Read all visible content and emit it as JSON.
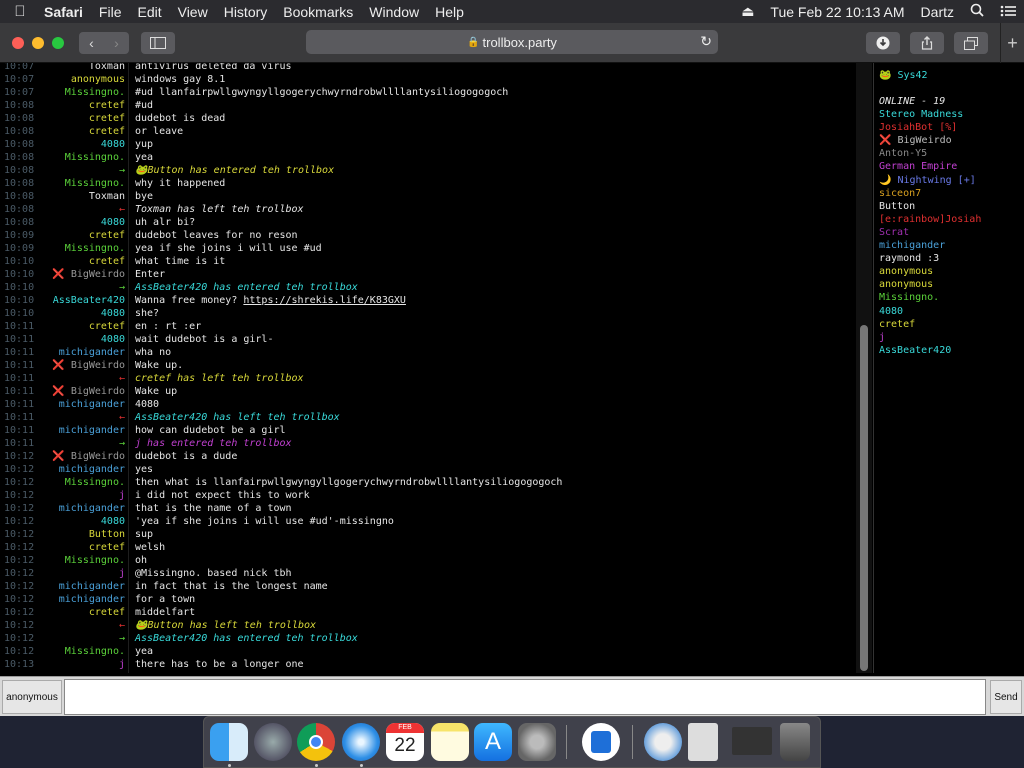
{
  "menubar": {
    "app": "Safari",
    "items": [
      "File",
      "Edit",
      "View",
      "History",
      "Bookmarks",
      "Window",
      "Help"
    ],
    "datetime": "Tue Feb 22  10:13 AM",
    "user": "Dartz"
  },
  "toolbar": {
    "url": "trollbox.party",
    "lock_icon": "🔒"
  },
  "colors": {
    "timestamp": "#4a5a66",
    "green": "#5bd13a",
    "cyan": "#39d9d9",
    "yellow": "#d8d83a",
    "blue": "#4aa0d8",
    "grey": "#999999"
  },
  "chat": {
    "messages": [
      {
        "time": "10:07",
        "nick": "Toxman",
        "nick_color": "#e6e6e6",
        "text": "antivirus deleted da virus",
        "sys": false
      },
      {
        "time": "10:07",
        "nick": "anonymous",
        "nick_color": "#d8d83a",
        "text": "windows gay 8.1",
        "sys": false
      },
      {
        "time": "10:07",
        "nick": "Missingno.",
        "nick_color": "#5bd13a",
        "text": "#ud llanfairpwllgwyngyllgogerychwyrndrobwllllantysiliogogogoch",
        "sys": false
      },
      {
        "time": "10:08",
        "nick": "cretef",
        "nick_color": "#d8d83a",
        "text": "#ud",
        "sys": false
      },
      {
        "time": "10:08",
        "nick": "cretef",
        "nick_color": "#d8d83a",
        "text": "dudebot is dead",
        "sys": false
      },
      {
        "time": "10:08",
        "nick": "cretef",
        "nick_color": "#d8d83a",
        "text": "or leave",
        "sys": false
      },
      {
        "time": "10:08",
        "nick": "4080",
        "nick_color": "#39d9d9",
        "text": "yup",
        "sys": false
      },
      {
        "time": "10:08",
        "nick": "Missingno.",
        "nick_color": "#5bd13a",
        "text": "yea",
        "sys": false
      },
      {
        "time": "10:08",
        "nick": "→",
        "nick_color": "#5bd13a",
        "text": "🐸Button has entered teh trollbox",
        "sys": true,
        "sys_color": "#d8d83a"
      },
      {
        "time": "10:08",
        "nick": "Missingno.",
        "nick_color": "#5bd13a",
        "text": "why it happened",
        "sys": false
      },
      {
        "time": "10:08",
        "nick": "Toxman",
        "nick_color": "#e6e6e6",
        "text": "bye",
        "sys": false
      },
      {
        "time": "10:08",
        "nick": "←",
        "nick_color": "#e03030",
        "text": "Toxman has left teh trollbox",
        "sys": true,
        "sys_color": "#e6e6e6"
      },
      {
        "time": "10:08",
        "nick": "4080",
        "nick_color": "#39d9d9",
        "text": "uh alr bi?",
        "sys": false
      },
      {
        "time": "10:09",
        "nick": "cretef",
        "nick_color": "#d8d83a",
        "text": "dudebot leaves for no reson",
        "sys": false
      },
      {
        "time": "10:09",
        "nick": "Missingno.",
        "nick_color": "#5bd13a",
        "text": "yea if she joins i will use #ud",
        "sys": false
      },
      {
        "time": "10:10",
        "nick": "cretef",
        "nick_color": "#d8d83a",
        "text": "what time is it",
        "sys": false
      },
      {
        "time": "10:10",
        "nick": "❌ BigWeirdo",
        "nick_color": "#999999",
        "text": "Enter",
        "sys": false
      },
      {
        "time": "10:10",
        "nick": "→",
        "nick_color": "#5bd13a",
        "text": "AssBeater420 has entered teh trollbox",
        "sys": true,
        "sys_color": "#39d9d9"
      },
      {
        "time": "10:10",
        "nick": "AssBeater420",
        "nick_color": "#39d9d9",
        "text": "Wanna free money? https://shrekis.life/K83GXU",
        "sys": false
      },
      {
        "time": "10:10",
        "nick": "4080",
        "nick_color": "#39d9d9",
        "text": "she?",
        "sys": false
      },
      {
        "time": "10:11",
        "nick": "cretef",
        "nick_color": "#d8d83a",
        "text": "en : rt :er",
        "sys": false
      },
      {
        "time": "10:11",
        "nick": "4080",
        "nick_color": "#39d9d9",
        "text": "wait dudebot is a girl-",
        "sys": false
      },
      {
        "time": "10:11",
        "nick": "michigander",
        "nick_color": "#4aa0d8",
        "text": "wha no",
        "sys": false
      },
      {
        "time": "10:11",
        "nick": "❌ BigWeirdo",
        "nick_color": "#999999",
        "text": "Wake up.",
        "sys": false
      },
      {
        "time": "10:11",
        "nick": "←",
        "nick_color": "#e03030",
        "text": "cretef has left teh trollbox",
        "sys": true,
        "sys_color": "#d8d83a"
      },
      {
        "time": "10:11",
        "nick": "❌ BigWeirdo",
        "nick_color": "#999999",
        "text": "Wake up",
        "sys": false
      },
      {
        "time": "10:11",
        "nick": "michigander",
        "nick_color": "#4aa0d8",
        "text": "4080",
        "sys": false
      },
      {
        "time": "10:11",
        "nick": "←",
        "nick_color": "#e03030",
        "text": "AssBeater420 has left teh trollbox",
        "sys": true,
        "sys_color": "#39d9d9"
      },
      {
        "time": "10:11",
        "nick": "michigander",
        "nick_color": "#4aa0d8",
        "text": "how can dudebot be a girl",
        "sys": false
      },
      {
        "time": "10:11",
        "nick": "→",
        "nick_color": "#5bd13a",
        "text": "j has entered teh trollbox",
        "sys": true,
        "sys_color": "#c040d0"
      },
      {
        "time": "10:12",
        "nick": "❌ BigWeirdo",
        "nick_color": "#999999",
        "text": "dudebot is a dude",
        "sys": false
      },
      {
        "time": "10:12",
        "nick": "michigander",
        "nick_color": "#4aa0d8",
        "text": "yes",
        "sys": false
      },
      {
        "time": "10:12",
        "nick": "Missingno.",
        "nick_color": "#5bd13a",
        "text": "then what is llanfairpwllgwyngyllgogerychwyrndrobwllllantysiliogogogoch",
        "sys": false
      },
      {
        "time": "10:12",
        "nick": "j",
        "nick_color": "#c040d0",
        "text": "i did not expect this to work",
        "sys": false
      },
      {
        "time": "10:12",
        "nick": "michigander",
        "nick_color": "#4aa0d8",
        "text": "that is the name of a town",
        "sys": false
      },
      {
        "time": "10:12",
        "nick": "4080",
        "nick_color": "#39d9d9",
        "text": "'yea if she joins i will use #ud'-missingno",
        "sys": false
      },
      {
        "time": "10:12",
        "nick": "Button",
        "nick_color": "#d8d83a",
        "text": "sup",
        "sys": false
      },
      {
        "time": "10:12",
        "nick": "cretef",
        "nick_color": "#d8d83a",
        "text": "welsh",
        "sys": false
      },
      {
        "time": "10:12",
        "nick": "Missingno.",
        "nick_color": "#5bd13a",
        "text": "oh",
        "sys": false
      },
      {
        "time": "10:12",
        "nick": "j",
        "nick_color": "#c040d0",
        "text": "@Missingno. based nick tbh",
        "sys": false
      },
      {
        "time": "10:12",
        "nick": "michigander",
        "nick_color": "#4aa0d8",
        "text": "in fact that is the longest name",
        "sys": false
      },
      {
        "time": "10:12",
        "nick": "michigander",
        "nick_color": "#4aa0d8",
        "text": "for a town",
        "sys": false
      },
      {
        "time": "10:12",
        "nick": "cretef",
        "nick_color": "#d8d83a",
        "text": "middelfart",
        "sys": false
      },
      {
        "time": "10:12",
        "nick": "←",
        "nick_color": "#e03030",
        "text": "🐸Button has left teh trollbox",
        "sys": true,
        "sys_color": "#d8d83a"
      },
      {
        "time": "10:12",
        "nick": "→",
        "nick_color": "#5bd13a",
        "text": "AssBeater420 has entered teh trollbox",
        "sys": true,
        "sys_color": "#39d9d9"
      },
      {
        "time": "10:12",
        "nick": "Missingno.",
        "nick_color": "#5bd13a",
        "text": "yea",
        "sys": false
      },
      {
        "time": "10:13",
        "nick": "j",
        "nick_color": "#c040d0",
        "text": "there has to be a longer one",
        "sys": false
      }
    ]
  },
  "users": {
    "top": "🐸 Sys42",
    "online_label": "ONLINE - 19",
    "list": [
      {
        "name": "Stereo Madness",
        "color": "#39d9d9"
      },
      {
        "name": "JosiahBot [%]",
        "color": "#e03030"
      },
      {
        "name": "❌ BigWeirdo",
        "color": "#bbbbbb"
      },
      {
        "name": "Anton-Y5",
        "color": "#888888"
      },
      {
        "name": "German Empire",
        "color": "#c040d0"
      },
      {
        "name": "🌙 Nightwing [+]",
        "color": "#6a7ae8"
      },
      {
        "name": "siceon7",
        "color": "#d8a020"
      },
      {
        "name": "Button",
        "color": "#e6e6e6"
      },
      {
        "name": "[e:rainbow]Josiah",
        "color": "#e03030"
      },
      {
        "name": "Scrat",
        "color": "#a030b0"
      },
      {
        "name": "michigander",
        "color": "#4aa0d8"
      },
      {
        "name": "raymond :3",
        "color": "#e6e6e6"
      },
      {
        "name": "anonymous",
        "color": "#d8d83a"
      },
      {
        "name": "anonymous",
        "color": "#d8d83a"
      },
      {
        "name": "Missingno.",
        "color": "#5bd13a"
      },
      {
        "name": "4080",
        "color": "#39d9d9"
      },
      {
        "name": "cretef",
        "color": "#d8d83a"
      },
      {
        "name": "j",
        "color": "#c040d0"
      },
      {
        "name": "AssBeater420",
        "color": "#39d9d9"
      }
    ]
  },
  "input": {
    "username": "anonymous",
    "message_value": "",
    "send_label": "Send"
  },
  "dock": {
    "calendar_month": "FEB",
    "calendar_day": "22"
  }
}
